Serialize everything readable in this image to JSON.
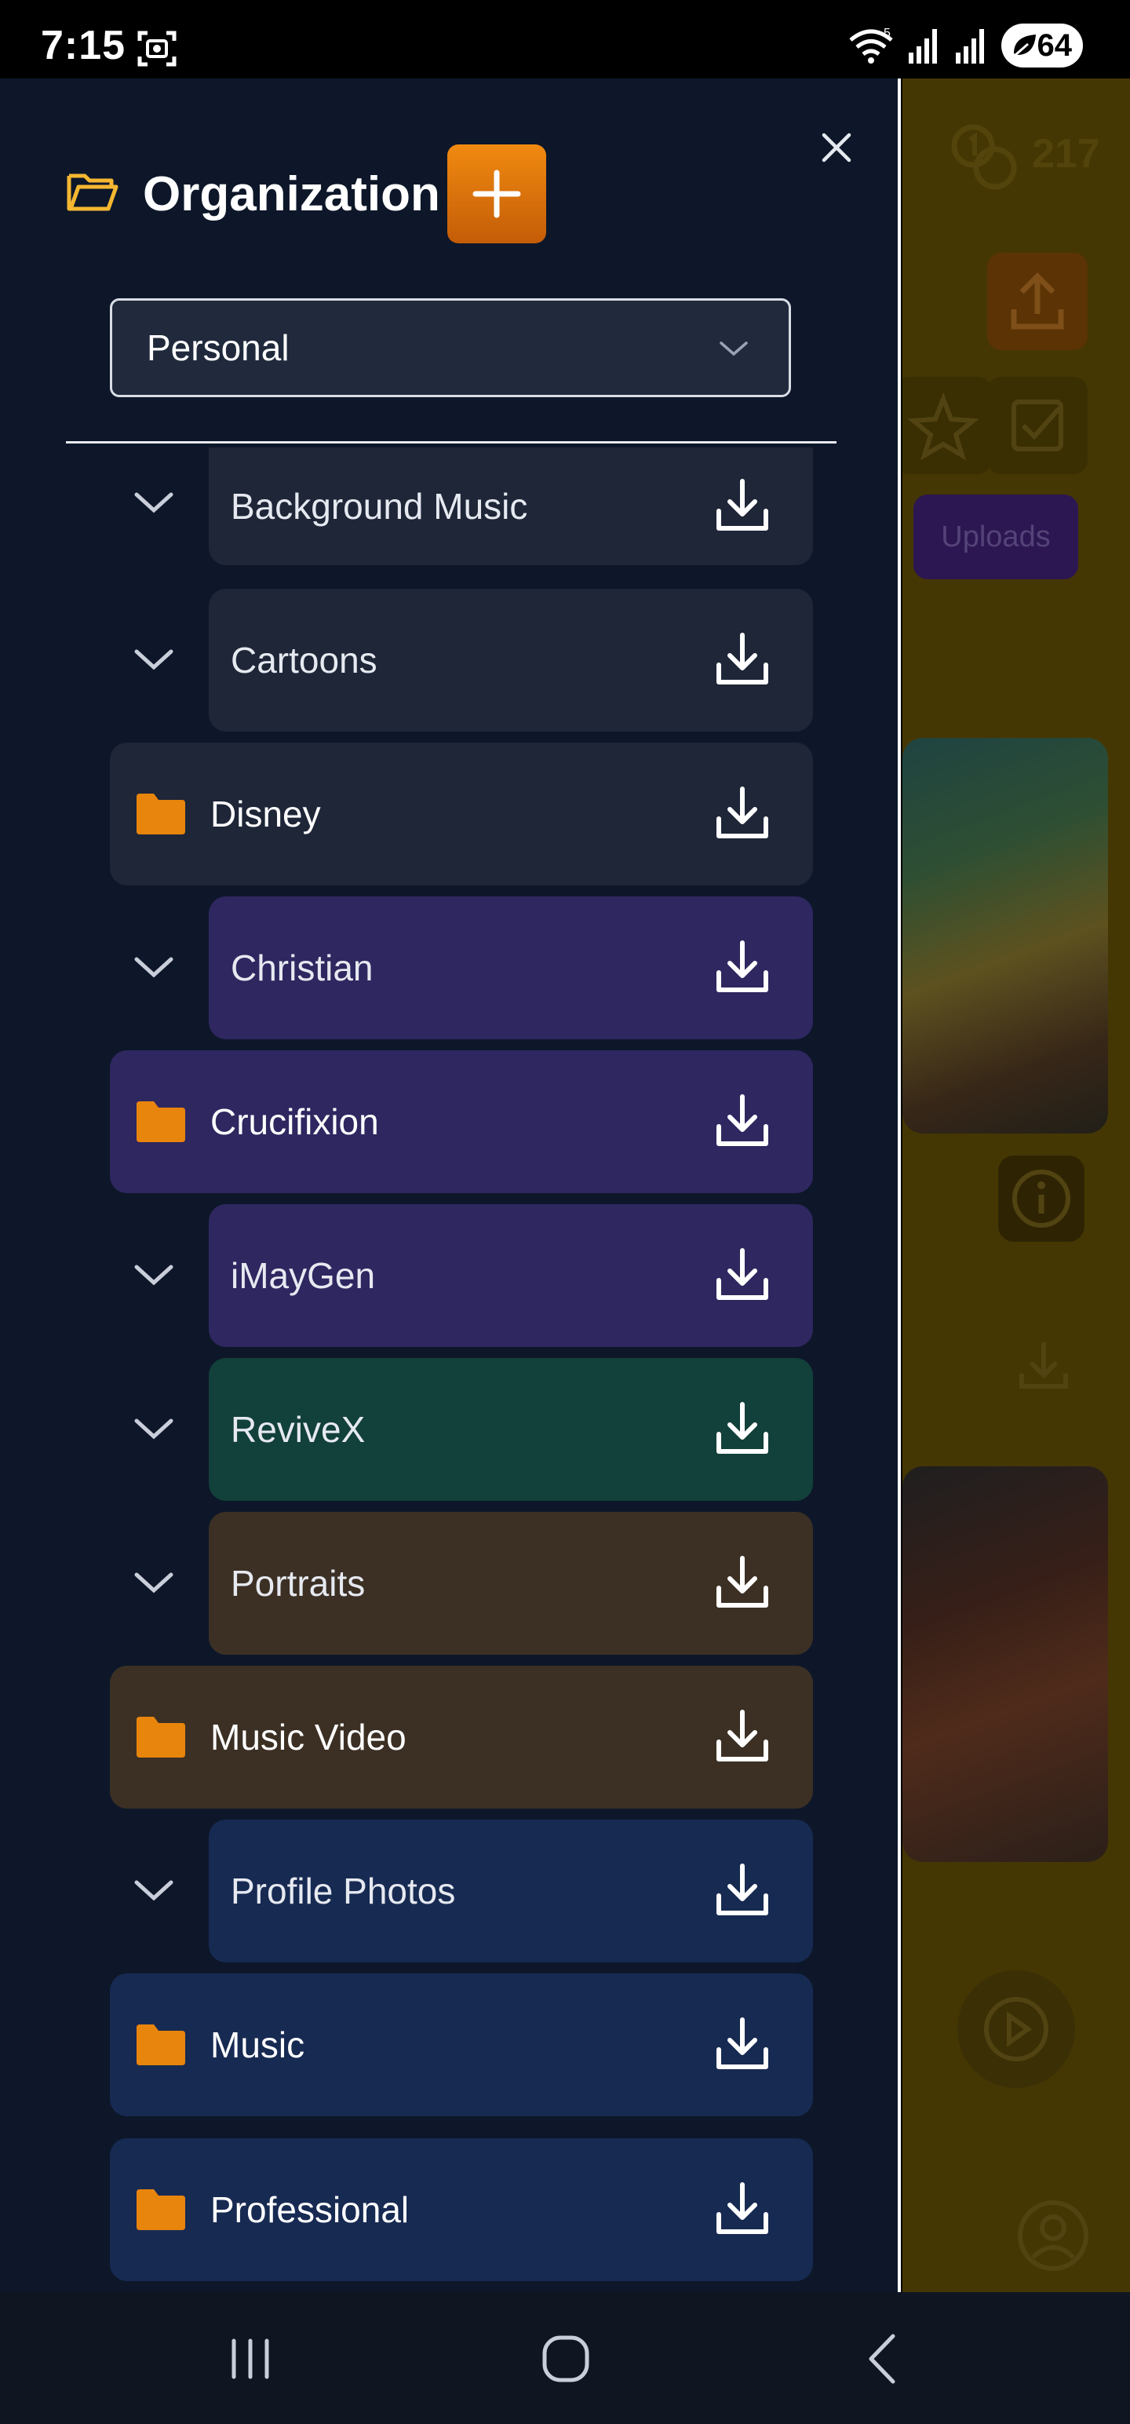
{
  "status_bar": {
    "time": "7:15",
    "battery": "64",
    "icons": [
      "screenshot-icon",
      "wifi-icon",
      "signal-icon",
      "signal-icon",
      "battery-saver-icon"
    ]
  },
  "drawer": {
    "title": "Organization",
    "add_label": "+",
    "select": {
      "value": "Personal"
    },
    "items": [
      {
        "label": "Background Music",
        "level": "sub",
        "color": "#1e2638"
      },
      {
        "label": "Cartoons",
        "level": "sub",
        "color": "#1e2638"
      },
      {
        "label": "Disney",
        "level": "top",
        "color": "#1e2638"
      },
      {
        "label": "Christian",
        "level": "sub",
        "color": "#2e2760"
      },
      {
        "label": "Crucifixion",
        "level": "top",
        "color": "#2e2760"
      },
      {
        "label": "iMayGen",
        "level": "sub",
        "color": "#2e2760"
      },
      {
        "label": "ReviveX",
        "level": "sub",
        "color": "#12403a"
      },
      {
        "label": "Portraits",
        "level": "sub",
        "color": "#3c3024"
      },
      {
        "label": "Music Video",
        "level": "top",
        "color": "#3c3024"
      },
      {
        "label": "Profile Photos",
        "level": "sub",
        "color": "#172a52"
      },
      {
        "label": "Music",
        "level": "top",
        "color": "#172a52"
      },
      {
        "label": "Professional",
        "level": "top",
        "color": "#172a52"
      }
    ]
  },
  "background": {
    "coin_count": "217",
    "uploads_label": "Uploads"
  },
  "colors": {
    "accent": "#e8850c",
    "drawer_bg": "#0d1729",
    "folder": "#e8850c"
  }
}
